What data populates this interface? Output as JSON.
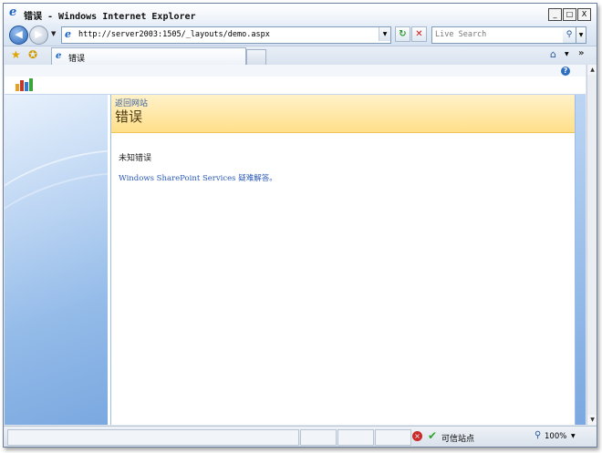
{
  "window": {
    "title": "错误 - Windows Internet Explorer",
    "controls": {
      "minimize": "_",
      "maximize": "□",
      "close": "X"
    }
  },
  "toolbar": {
    "back_icon": "back-arrow-icon",
    "forward_icon": "forward-arrow-icon",
    "address": "http://server2003:1505/_layouts/demo.aspx",
    "search_placeholder": "Live Search"
  },
  "tabs": [
    {
      "label": "错误",
      "active": true
    }
  ],
  "page": {
    "back_link": "返回网站",
    "title": "错误",
    "error_message": "未知错误",
    "help_link": "Windows SharePoint Services 疑难解答。"
  },
  "statusbar": {
    "zone": "可信站点",
    "zoom": "100%"
  },
  "colors": {
    "banner": "#ffdf8a",
    "link": "#2a5ab8",
    "side_panel": "#95bce9"
  }
}
